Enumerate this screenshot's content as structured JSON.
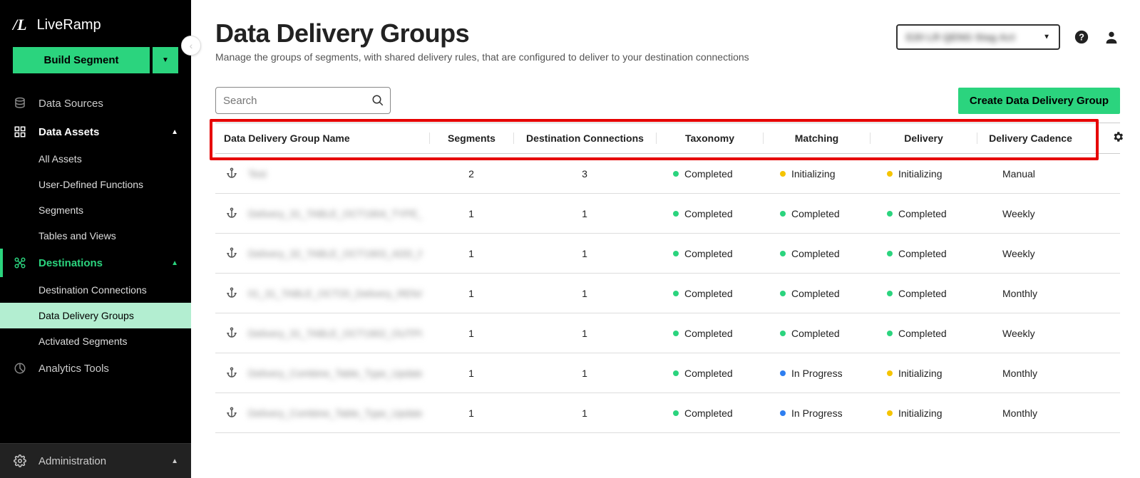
{
  "brand": {
    "logo": "/L",
    "name": "LiveRamp"
  },
  "build_button": "Build Segment",
  "collapse_glyph": "‹",
  "nav": {
    "data_sources": "Data Sources",
    "data_assets": "Data Assets",
    "all_assets": "All Assets",
    "udf": "User-Defined Functions",
    "segments": "Segments",
    "tables": "Tables and Views",
    "destinations": "Destinations",
    "dest_conn": "Destination Connections",
    "ddg": "Data Delivery Groups",
    "act_seg": "Activated Segments",
    "analytics": "Analytics Tools",
    "admin": "Administration"
  },
  "header": {
    "title": "Data Delivery Groups",
    "subtitle": "Manage the groups of segments, with shared delivery rules, that are configured to deliver to your destination connections",
    "account_blur": "E20 LR QENG Stag Act"
  },
  "search_placeholder": "Search",
  "create_button": "Create Data Delivery Group",
  "columns": {
    "name": "Data Delivery Group Name",
    "segments": "Segments",
    "dest": "Destination Connections",
    "taxonomy": "Taxonomy",
    "matching": "Matching",
    "delivery": "Delivery",
    "cadence": "Delivery Cadence"
  },
  "rows": [
    {
      "name_blur": "Test",
      "segments": "2",
      "dest": "3",
      "tax": {
        "dot": "green",
        "label": "Completed"
      },
      "match": {
        "dot": "yellow",
        "label": "Initializing"
      },
      "del": {
        "dot": "yellow",
        "label": "Initializing"
      },
      "cad": "Manual"
    },
    {
      "name_blur": "Delivery_31_TABLE_OCT1904_TYPE_UPDATE_C",
      "segments": "1",
      "dest": "1",
      "tax": {
        "dot": "green",
        "label": "Completed"
      },
      "match": {
        "dot": "green",
        "label": "Completed"
      },
      "del": {
        "dot": "green",
        "label": "Completed"
      },
      "cad": "Weekly"
    },
    {
      "name_blur": "Delivery_32_TABLE_OCT1903_ADD_PROPERTY",
      "segments": "1",
      "dest": "1",
      "tax": {
        "dot": "green",
        "label": "Completed"
      },
      "match": {
        "dot": "green",
        "label": "Completed"
      },
      "del": {
        "dot": "green",
        "label": "Completed"
      },
      "cad": "Weekly"
    },
    {
      "name_blur": "01_31_TABLE_OCT20_Delivery_RENAME_OUT",
      "segments": "1",
      "dest": "1",
      "tax": {
        "dot": "green",
        "label": "Completed"
      },
      "match": {
        "dot": "green",
        "label": "Completed"
      },
      "del": {
        "dot": "green",
        "label": "Completed"
      },
      "cad": "Monthly"
    },
    {
      "name_blur": "Delivery_31_TABLE_OCT1902_OUTPUT",
      "segments": "1",
      "dest": "1",
      "tax": {
        "dot": "green",
        "label": "Completed"
      },
      "match": {
        "dot": "green",
        "label": "Completed"
      },
      "del": {
        "dot": "green",
        "label": "Completed"
      },
      "cad": "Weekly"
    },
    {
      "name_blur": "Delivery_Combine_Table_Type_Update_31",
      "segments": "1",
      "dest": "1",
      "tax": {
        "dot": "green",
        "label": "Completed"
      },
      "match": {
        "dot": "blue",
        "label": "In Progress"
      },
      "del": {
        "dot": "yellow",
        "label": "Initializing"
      },
      "cad": "Monthly"
    },
    {
      "name_blur": "Delivery_Combine_Table_Type_Update_31",
      "segments": "1",
      "dest": "1",
      "tax": {
        "dot": "green",
        "label": "Completed"
      },
      "match": {
        "dot": "blue",
        "label": "In Progress"
      },
      "del": {
        "dot": "yellow",
        "label": "Initializing"
      },
      "cad": "Monthly"
    }
  ]
}
